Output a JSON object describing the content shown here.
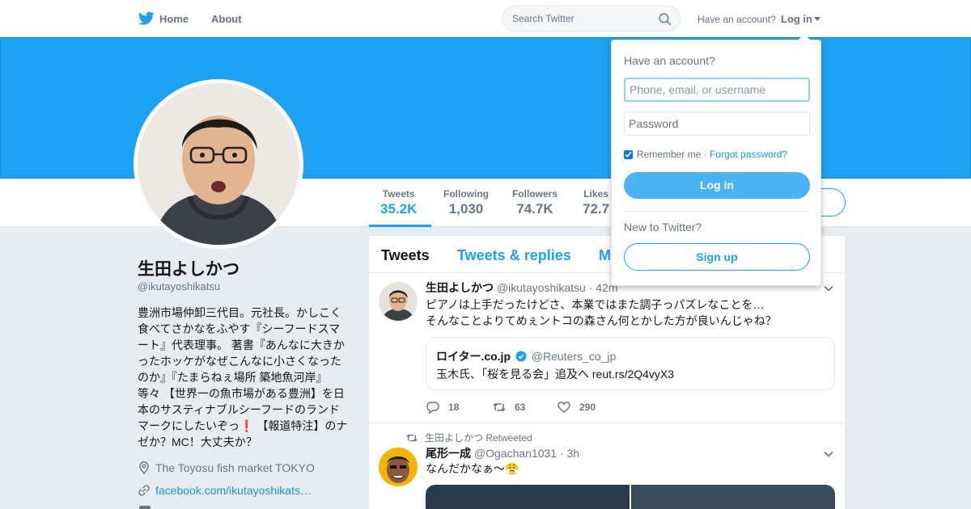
{
  "nav": {
    "home": "Home",
    "about": "About",
    "search_placeholder": "Search Twitter",
    "have_account": "Have an account?",
    "login": "Log in"
  },
  "profile": {
    "name": "生田よしかつ",
    "handle": "@ikutayoshikatsu",
    "bio": "豊洲市場仲卸三代目。元社長。かしこく食べてさかなをふやす『シーフードスマート』代表理事。 著書『あんなに大きかったホッケがなぜこんなに小さくなったのか』『たまらねぇ場所 築地魚河岸』等々 【世界一の魚市場がある豊洲】を日本のサスティナブルシーフードのランドマークにしたいぞっ❗️ 【報道特注】のナゼか？MC！大丈夫か？",
    "location": "The Toyosu fish market TOKYO",
    "url": "facebook.com/ikutayoshikats…"
  },
  "stats": [
    {
      "label": "Tweets",
      "value": "35.2K"
    },
    {
      "label": "Following",
      "value": "1,030"
    },
    {
      "label": "Followers",
      "value": "74.7K"
    },
    {
      "label": "Likes",
      "value": "72.7"
    }
  ],
  "tabs": [
    "Tweets",
    "Tweets & replies",
    "M"
  ],
  "tweets": [
    {
      "name": "生田よしかつ",
      "handle": "@ikutayoshikatsu",
      "time": "· 42m",
      "lines": [
        "ピアノは上手だったけどさ、本業ではまた調子っパズレなことを…",
        "そんなことよりてめぇントコの森さん何とかした方が良いんじゃね？"
      ],
      "quote": {
        "name": "ロイター.co.jp",
        "handle": "@Reuters_co_jp",
        "text": "玉木氏、「桜を見る会」追及へ  reut.rs/2Q4vyX3"
      },
      "replies": "18",
      "retweets": "63",
      "likes": "290"
    },
    {
      "retweet_context": "生田よしかつ Retweeted",
      "name": "尾形一成",
      "handle": "@Ogachan1031",
      "time": "· 3h",
      "text": "なんだかなぁ〜😤"
    }
  ],
  "login_dropdown": {
    "title": "Have an account?",
    "username_placeholder": "Phone, email, or username",
    "password_placeholder": "Password",
    "remember_me": "Remember me",
    "separator": " · ",
    "forgot_password": "Forgot password?",
    "login_button": "Log in",
    "new_to_twitter": "New to Twitter?",
    "signup_button": "Sign up"
  },
  "colors": {
    "brand_blue": "#1da1f2",
    "link_blue": "#1b95e0",
    "gray_text": "#657786",
    "background": "#e6ecf0"
  }
}
